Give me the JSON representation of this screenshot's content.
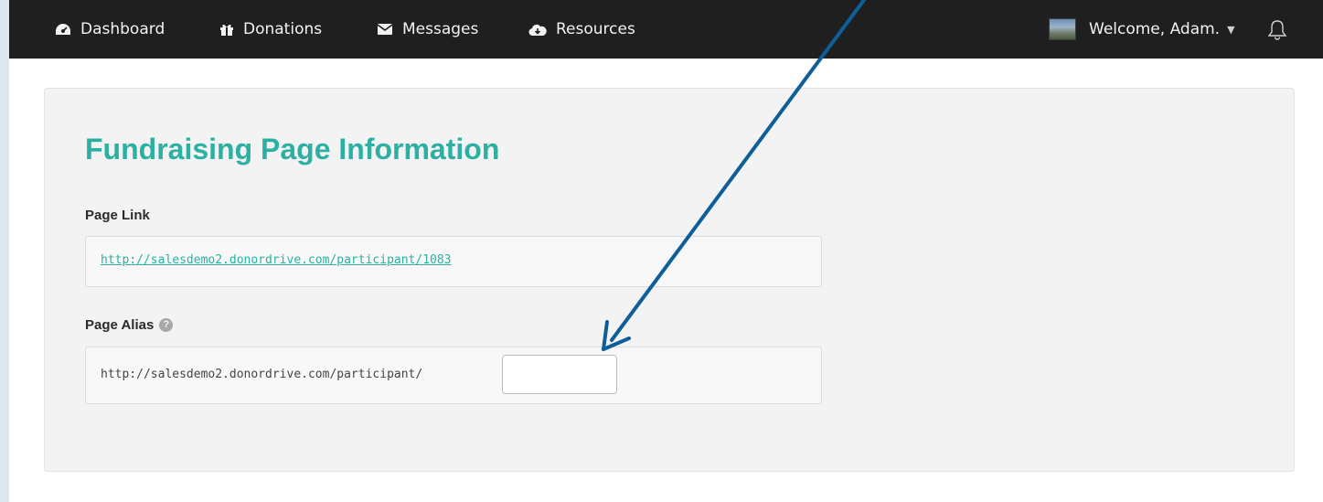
{
  "nav": {
    "items": [
      {
        "label": "Dashboard",
        "icon": "dashboard-icon"
      },
      {
        "label": "Donations",
        "icon": "gift-icon"
      },
      {
        "label": "Messages",
        "icon": "envelope-icon"
      },
      {
        "label": "Resources",
        "icon": "cloud-download-icon"
      }
    ],
    "welcome": "Welcome, Adam.",
    "bell_icon": "bell-icon",
    "background": "#1f1f1f"
  },
  "card": {
    "title": "Fundraising Page Information",
    "title_color": "#2bb0a3",
    "page_link": {
      "label": "Page Link",
      "url": "http://salesdemo2.donordrive.com/participant/1083"
    },
    "page_alias": {
      "label": "Page Alias",
      "help_icon": "question-circle-icon",
      "prefix": "http://salesdemo2.donordrive.com/participant/",
      "value": "",
      "placeholder": ""
    }
  },
  "annotation": {
    "arrow_color": "#0e5f99"
  }
}
